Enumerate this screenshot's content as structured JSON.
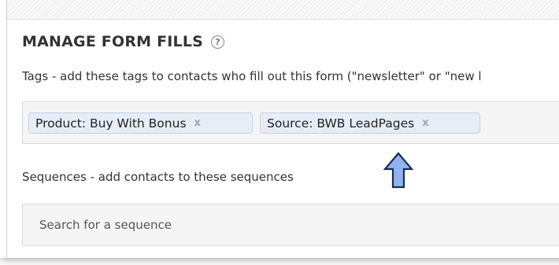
{
  "header": {
    "title": "MANAGE FORM FILLS",
    "help_glyph": "?"
  },
  "tags": {
    "description": "Tags - add these tags to contacts who fill out this form (\"newsletter\" or \"new l",
    "items": [
      {
        "label": "Product: Buy With Bonus",
        "remove": "x"
      },
      {
        "label": "Source: BWB LeadPages",
        "remove": "x"
      }
    ]
  },
  "sequences": {
    "description": "Sequences - add contacts to these sequences",
    "search_placeholder": "Search for a sequence"
  },
  "colors": {
    "tag_bg": "#e6edf6",
    "tag_border": "#c4d1e2",
    "arrow_fill": "#8fb4f0",
    "arrow_stroke": "#1c2c4e"
  },
  "icons": [
    "help-icon",
    "remove-icon",
    "up-arrow-icon"
  ]
}
